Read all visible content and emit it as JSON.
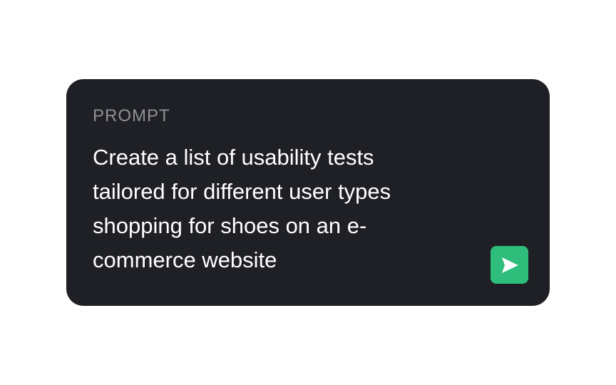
{
  "prompt": {
    "label": "PROMPT",
    "text": "Create a list of usability tests tailored for different user types shopping for shoes on an e-commerce website",
    "send_icon": "send-arrow-icon",
    "accent_color": "#2ebd7a",
    "card_color": "#1f2025"
  }
}
